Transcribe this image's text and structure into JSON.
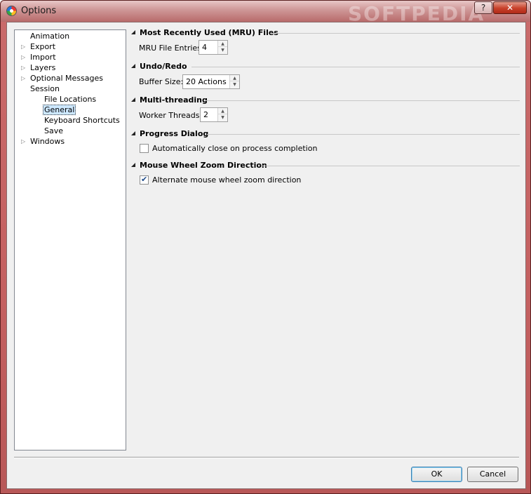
{
  "window": {
    "title": "Options",
    "watermark": "SOFTPEDIA",
    "help_label": "?",
    "close_label": "✕"
  },
  "tree": {
    "items": [
      {
        "label": "Animation",
        "expandable": false,
        "level": 0
      },
      {
        "label": "Export",
        "expandable": true,
        "level": 0
      },
      {
        "label": "Import",
        "expandable": true,
        "level": 0
      },
      {
        "label": "Layers",
        "expandable": true,
        "level": 0
      },
      {
        "label": "Optional Messages",
        "expandable": true,
        "level": 0
      },
      {
        "label": "Session",
        "expandable": false,
        "level": 0
      },
      {
        "label": "File Locations",
        "expandable": false,
        "level": 1
      },
      {
        "label": "General",
        "expandable": false,
        "level": 1,
        "selected": true
      },
      {
        "label": "Keyboard Shortcuts",
        "expandable": false,
        "level": 1
      },
      {
        "label": "Save",
        "expandable": false,
        "level": 1
      },
      {
        "label": "Windows",
        "expandable": true,
        "level": 0
      }
    ]
  },
  "groups": {
    "mru": {
      "title": "Most Recently Used (MRU) Files",
      "field_label": "MRU File Entries:",
      "value": "4"
    },
    "undo": {
      "title": "Undo/Redo",
      "field_label": "Buffer Size:",
      "value": "20 Actions"
    },
    "threading": {
      "title": "Multi-threading",
      "field_label": "Worker Threads:",
      "value": "2"
    },
    "progress": {
      "title": "Progress Dialog",
      "checkbox_label": "Automatically close on process completion",
      "checked": false
    },
    "wheel": {
      "title": "Mouse Wheel Zoom Direction",
      "checkbox_label": "Alternate mouse wheel zoom direction",
      "checked": true
    }
  },
  "buttons": {
    "ok": "OK",
    "cancel": "Cancel"
  },
  "icons": {
    "up": "▲",
    "down": "▼",
    "expander": "▷",
    "check": "✔"
  }
}
